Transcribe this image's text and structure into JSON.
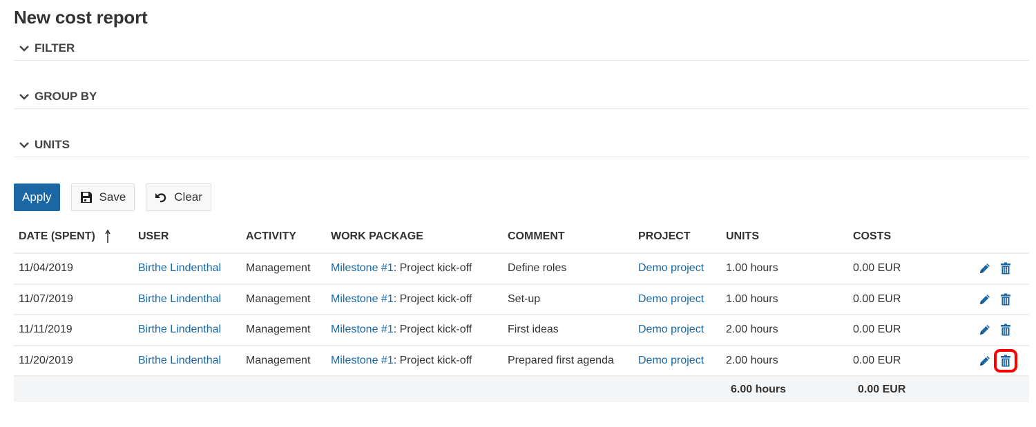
{
  "page": {
    "title": "New cost report"
  },
  "sections": [
    {
      "label": "FILTER",
      "icon": "chevron-down-icon"
    },
    {
      "label": "GROUP BY",
      "icon": "chevron-down-icon"
    },
    {
      "label": "UNITS",
      "icon": "chevron-down-icon"
    }
  ],
  "toolbar": {
    "apply_label": "Apply",
    "save_label": "Save",
    "save_icon": "floppy-disk-icon",
    "clear_label": "Clear",
    "clear_icon": "undo-icon"
  },
  "colors": {
    "primary": "#1a67a3",
    "link": "#1a67a3",
    "highlight": "#ff0000",
    "sum_row_bg": "#f4f5f7"
  },
  "table": {
    "columns": [
      {
        "label": "DATE (SPENT)",
        "sorted": "ascending"
      },
      {
        "label": "USER"
      },
      {
        "label": "ACTIVITY"
      },
      {
        "label": "WORK PACKAGE"
      },
      {
        "label": "COMMENT"
      },
      {
        "label": "PROJECT"
      },
      {
        "label": "UNITS"
      },
      {
        "label": "COSTS"
      }
    ],
    "rows": [
      {
        "date": "11/04/2019",
        "user": "Birthe Lindenthal",
        "activity": "Management",
        "wp_link": "Milestone #1",
        "wp_title": ": Project kick-off",
        "comment": "Define roles",
        "project": "Demo project",
        "units": "1.00 hours",
        "costs": "0.00 EUR"
      },
      {
        "date": "11/07/2019",
        "user": "Birthe Lindenthal",
        "activity": "Management",
        "wp_link": "Milestone #1",
        "wp_title": ": Project kick-off",
        "comment": "Set-up",
        "project": "Demo project",
        "units": "1.00 hours",
        "costs": "0.00 EUR"
      },
      {
        "date": "11/11/2019",
        "user": "Birthe Lindenthal",
        "activity": "Management",
        "wp_link": "Milestone #1",
        "wp_title": ": Project kick-off",
        "comment": "First ideas",
        "project": "Demo project",
        "units": "2.00 hours",
        "costs": "0.00 EUR"
      },
      {
        "date": "11/20/2019",
        "user": "Birthe Lindenthal",
        "activity": "Management",
        "wp_link": "Milestone #1",
        "wp_title": ": Project kick-off",
        "comment": "Prepared first agenda",
        "project": "Demo project",
        "units": "2.00 hours",
        "costs": "0.00 EUR",
        "delete_highlighted": true
      }
    ],
    "row_actions": [
      "edit-icon",
      "delete-icon"
    ],
    "totals": {
      "units": "6.00 hours",
      "costs": "0.00 EUR"
    }
  }
}
